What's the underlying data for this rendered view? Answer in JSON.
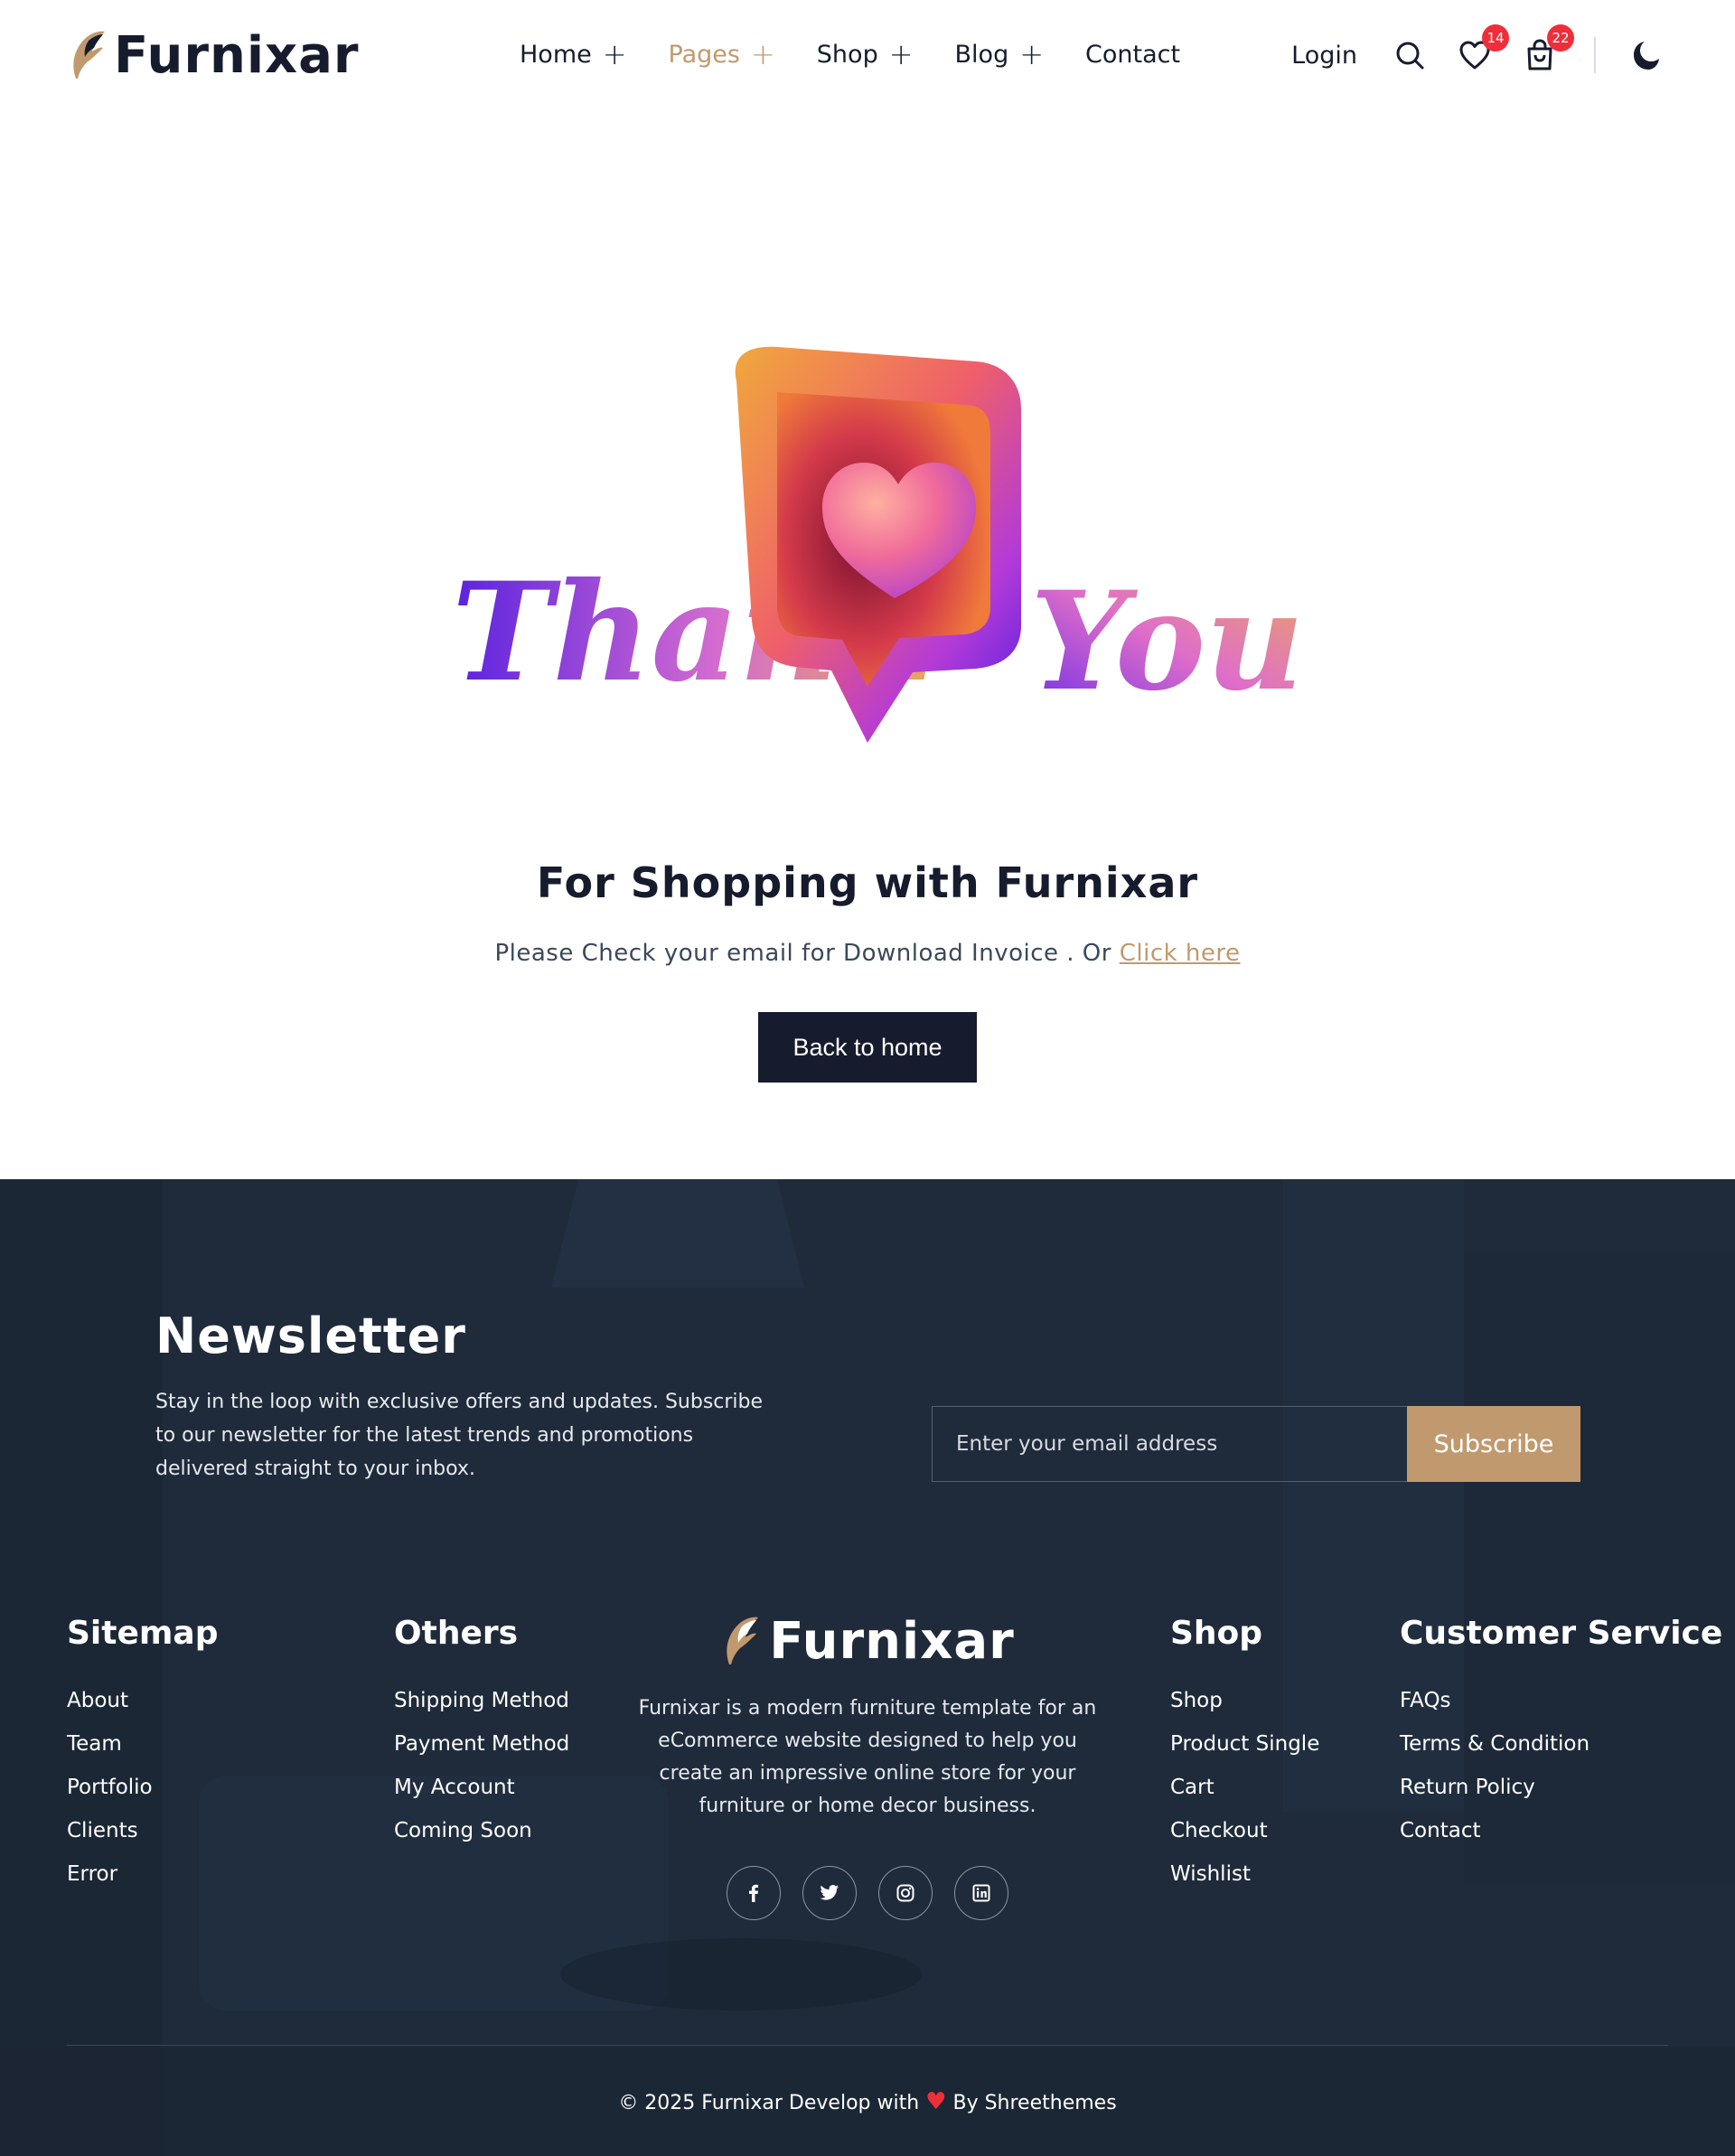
{
  "brand": {
    "name": "Furnixar"
  },
  "nav": {
    "items": [
      {
        "label": "Home",
        "has_sub": true
      },
      {
        "label": "Pages",
        "has_sub": true,
        "active": true
      },
      {
        "label": "Shop",
        "has_sub": true
      },
      {
        "label": "Blog",
        "has_sub": true
      },
      {
        "label": "Contact",
        "has_sub": false
      }
    ],
    "plus": "+"
  },
  "header": {
    "login_label": "Login",
    "wishlist_count": "14",
    "cart_count": "22",
    "icons": [
      "search-icon",
      "heart-icon",
      "shopping-bag-icon",
      "moon-icon"
    ]
  },
  "hero": {
    "art_word_left": "Thank",
    "art_word_right": "You",
    "heading": "For Shopping with Furnixar",
    "subtext_prefix": "Please Check your email for Download Invoice . Or ",
    "subtext_link": "Click here",
    "back_button": "Back to home"
  },
  "newsletter": {
    "title": "Newsletter",
    "text": "Stay in the loop with exclusive offers and updates. Subscribe to our newsletter for the latest trends and promotions delivered straight to your inbox.",
    "placeholder": "Enter your email address",
    "button": "Subscribe"
  },
  "footer": {
    "sitemap": {
      "title": "Sitemap",
      "links": [
        "About",
        "Team",
        "Portfolio",
        "Clients",
        "Error"
      ]
    },
    "others": {
      "title": "Others",
      "links": [
        "Shipping Method",
        "Payment Method",
        "My Account",
        "Coming Soon"
      ]
    },
    "brand_desc": "Furnixar is a modern furniture template for an eCommerce website designed to help you create an impressive online store for your furniture or home decor business.",
    "socials": [
      "facebook-icon",
      "twitter-icon",
      "instagram-icon",
      "linkedin-icon"
    ],
    "shop": {
      "title": "Shop",
      "links": [
        "Shop",
        "Product Single",
        "Cart",
        "Checkout",
        "Wishlist"
      ]
    },
    "customer_service": {
      "title": "Customer Service",
      "links": [
        "FAQs",
        "Terms & Condition",
        "Return Policy",
        "Contact"
      ]
    },
    "copyright_prefix": "© 2025 Furnixar Develop with",
    "copyright_suffix": "By Shreethemes"
  },
  "colors": {
    "accent": "#c09a6e",
    "dark": "#161c2d",
    "footer_bg": "#1e2a3a",
    "badge": "#ef2e3a"
  }
}
